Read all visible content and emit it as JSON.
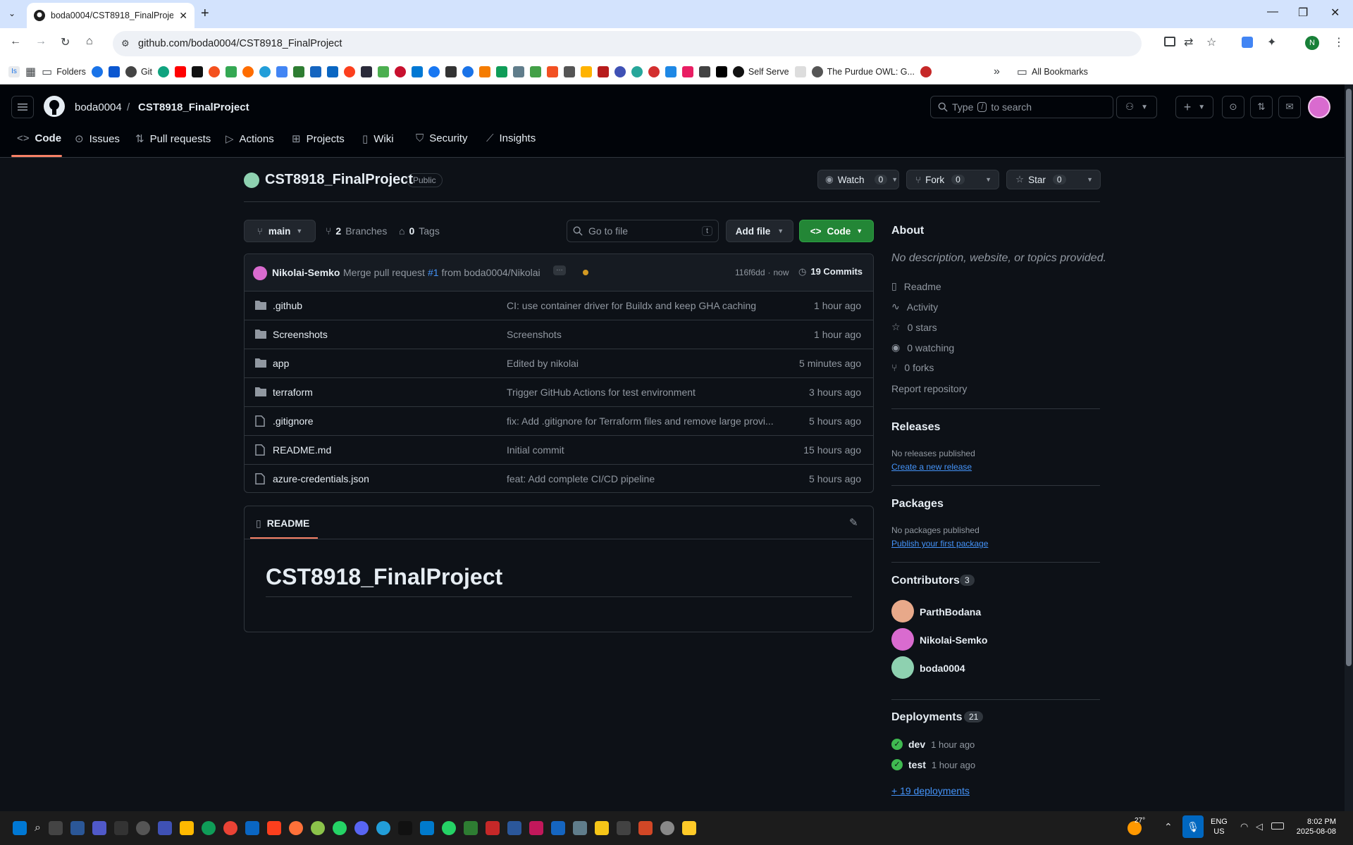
{
  "browser": {
    "tab_title": "boda0004/CST8918_FinalProject",
    "url": "github.com/boda0004/CST8918_FinalProject",
    "bookmarks_folders": "Folders",
    "bookmark_git": "Git",
    "bookmark_self_serve": "Self Serve",
    "bookmark_purdue": "The Purdue OWL: G...",
    "all_bookmarks": "All Bookmarks",
    "bookmark_is": "Is",
    "profile_initial": "N"
  },
  "header": {
    "owner": "boda0004",
    "separator": "/",
    "repo": "CST8918_FinalProject",
    "search_placeholder_pre": "Type",
    "search_key": "/",
    "search_placeholder_post": "to search"
  },
  "nav": {
    "code": "Code",
    "issues": "Issues",
    "pull_requests": "Pull requests",
    "actions": "Actions",
    "projects": "Projects",
    "wiki": "Wiki",
    "security": "Security",
    "insights": "Insights"
  },
  "repo": {
    "name": "CST8918_FinalProject",
    "visibility": "Public",
    "watch_label": "Watch",
    "watch_count": "0",
    "fork_label": "Fork",
    "fork_count": "0",
    "star_label": "Star",
    "star_count": "0"
  },
  "toolbar": {
    "branch": "main",
    "branches_count": "2",
    "branches_label": "Branches",
    "tags_count": "0",
    "tags_label": "Tags",
    "go_to_file": "Go to file",
    "go_to_file_key": "t",
    "add_file": "Add file",
    "code": "Code"
  },
  "commit": {
    "author": "Nikolai-Semko",
    "message_pre": "Merge pull request",
    "pr": "#1",
    "message_post": "from boda0004/Nikolai",
    "sha": "116f6dd",
    "dot": "·",
    "time": "now",
    "commits": "19 Commits"
  },
  "files": [
    {
      "name": ".github",
      "type": "folder",
      "message": "CI: use container driver for Buildx and keep GHA caching",
      "time": "1 hour ago"
    },
    {
      "name": "Screenshots",
      "type": "folder",
      "message": "Screenshots",
      "time": "1 hour ago"
    },
    {
      "name": "app",
      "type": "folder",
      "message": "Edited by nikolai",
      "time": "5 minutes ago"
    },
    {
      "name": "terraform",
      "type": "folder",
      "message": "Trigger GitHub Actions for test environment",
      "time": "3 hours ago"
    },
    {
      "name": ".gitignore",
      "type": "file",
      "message": "fix: Add .gitignore for Terraform files and remove large provi...",
      "time": "5 hours ago"
    },
    {
      "name": "README.md",
      "type": "file",
      "message": "Initial commit",
      "time": "15 hours ago"
    },
    {
      "name": "azure-credentials.json",
      "type": "file",
      "message": "feat: Add complete CI/CD pipeline",
      "time": "5 hours ago"
    }
  ],
  "readme": {
    "tab": "README",
    "heading": "CST8918_FinalProject"
  },
  "about": {
    "title": "About",
    "description": "No description, website, or topics provided.",
    "readme": "Readme",
    "activity": "Activity",
    "stars": "0 stars",
    "watching": "0 watching",
    "forks": "0 forks",
    "report": "Report repository"
  },
  "releases": {
    "title": "Releases",
    "none": "No releases published",
    "create": "Create a new release"
  },
  "packages": {
    "title": "Packages",
    "none": "No packages published",
    "publish": "Publish your first package"
  },
  "contributors": {
    "title": "Contributors",
    "count": "3",
    "list": [
      "ParthBodana",
      "Nikolai-Semko",
      "boda0004"
    ]
  },
  "deployments": {
    "title": "Deployments",
    "count": "21",
    "items": [
      {
        "env": "dev",
        "time": "1 hour ago"
      },
      {
        "env": "test",
        "time": "1 hour ago"
      }
    ],
    "more": "+ 19 deployments"
  },
  "taskbar": {
    "weather_temp": "27°",
    "lang": "ENG",
    "region": "US",
    "time": "8:02 PM",
    "date": "2025-08-08"
  },
  "colors": {
    "accent_green": "#238636",
    "link_blue": "#4493f8",
    "tab_underline": "#f78166",
    "success": "#3fb950"
  }
}
